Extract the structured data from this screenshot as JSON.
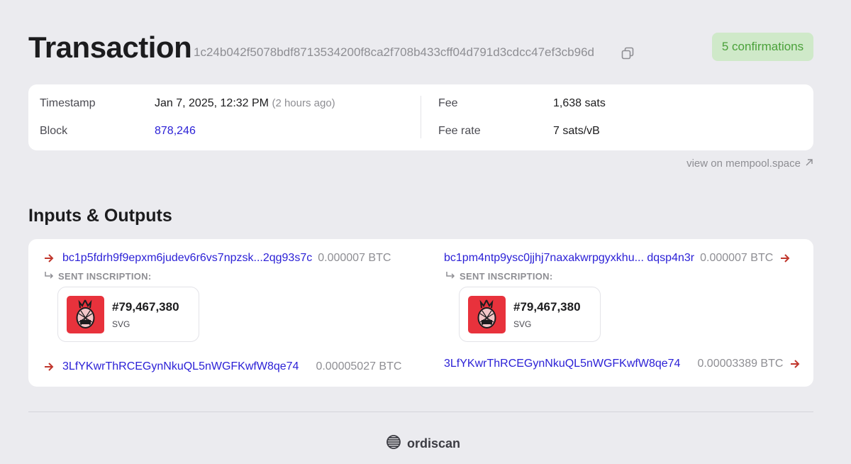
{
  "header": {
    "title": "Transaction",
    "txid": "1c24b042f5078bdf8713534200f8ca2f708b433cff04d791d3cdcc47ef3cb96d",
    "confirmations": "5 confirmations"
  },
  "info": {
    "timestamp_label": "Timestamp",
    "timestamp_value": "Jan 7, 2025, 12:32 PM",
    "timestamp_relative": "(2 hours ago)",
    "block_label": "Block",
    "block_value": "878,246",
    "fee_label": "Fee",
    "fee_value": "1,638 sats",
    "fee_rate_label": "Fee rate",
    "fee_rate_value": "7 sats/vB"
  },
  "mempool_link": "view on mempool.space",
  "section_title": "Inputs & Outputs",
  "inputs": [
    {
      "address": "bc1p5fdrh9f9epxm6judev6r6vs7npzsk...2qg93s7c",
      "amount": "0.000007 BTC",
      "sent_label": "SENT INSCRIPTION:",
      "inscription": {
        "number": "#79,467,380",
        "type": "SVG"
      }
    },
    {
      "address": "3LfYKwrThRCEGynNkuQL5nWGFKwfW8qe74",
      "amount": "0.00005027 BTC"
    }
  ],
  "outputs": [
    {
      "address": "bc1pm4ntp9ysc0jjhj7naxakwrpgyxkhu... dqsp4n3r",
      "amount": "0.000007 BTC",
      "sent_label": "SENT INSCRIPTION:",
      "inscription": {
        "number": "#79,467,380",
        "type": "SVG"
      }
    },
    {
      "address": "3LfYKwrThRCEGynNkuQL5nWGFKwfW8qe74",
      "amount": "0.00003389 BTC"
    }
  ],
  "footer": {
    "brand": "ordiscan"
  },
  "colors": {
    "link": "#2a1fd6",
    "arrow": "#c0362c",
    "badge_bg": "#cfe9c9",
    "badge_text": "#4aa13a",
    "inscription_bg": "#e8323c"
  },
  "icons": {
    "copy": "copy-icon",
    "external": "external-link-icon",
    "arrow": "arrow-right-icon",
    "reply": "reply-arrow-icon",
    "brand": "ordiscan-logo-icon",
    "thumbnail": "pineapple-icon"
  }
}
